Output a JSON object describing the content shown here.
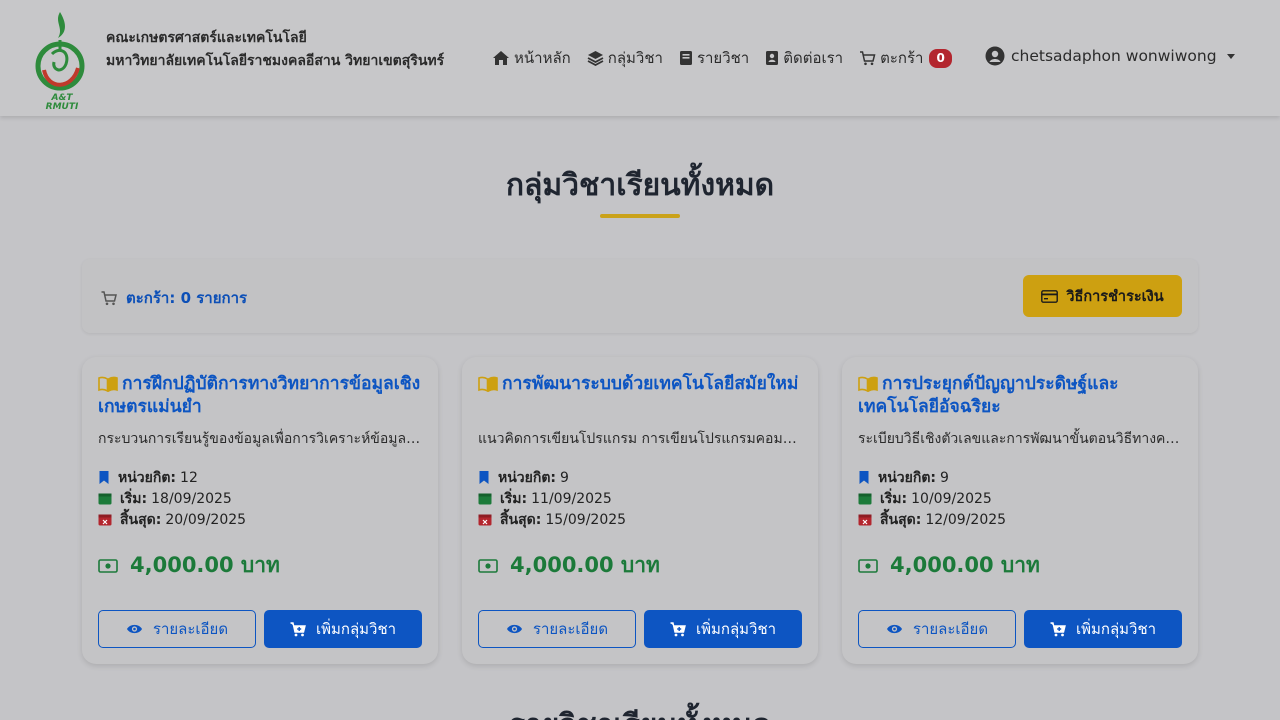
{
  "brand": {
    "logo_text": "A&T RMUTI",
    "line1": "คณะเกษตรศาสตร์และเทคโนโลยี",
    "line2": "มหาวิทยาลัยเทคโนโลยีราชมงคลอีสาน วิทยาเขตสุรินทร์"
  },
  "nav": {
    "home": "หน้าหลัก",
    "groups": "กลุ่มวิชา",
    "subjects": "รายวิชา",
    "contact": "ติดต่อเรา",
    "cart": "ตะกร้า",
    "cart_count": "0",
    "user": "chetsadaphon wonwiwong"
  },
  "page_title": "กลุ่มวิชาเรียนทั้งหมด",
  "cart_bar": {
    "summary": "ตะกร้า: 0 รายการ",
    "pay_button": "วิธีการชำระเงิน"
  },
  "labels": {
    "credits": "หน่วยกิต:",
    "start": "เริ่ม:",
    "end": "สิ้นสุด:",
    "detail_button": "รายละเอียด",
    "add_button": "เพิ่มกลุ่มวิชา"
  },
  "courses": [
    {
      "title": "การฝึกปฏิบัติการทางวิทยาการข้อมูลเชิงเกษตรแม่นยำ",
      "description": "กระบวนการเรียนรู้ของข้อมูลเพื่อการวิเคราะห์ข้อมูลเชิงเกษตรแม่นยำ",
      "credits": "12",
      "start": "18/09/2025",
      "end": "20/09/2025",
      "price": "4,000.00 บาท"
    },
    {
      "title": "การพัฒนาระบบด้วยเทคโนโลยีสมัยใหม่",
      "description": "แนวคิดการเขียนโปรแกรม การเขียนโปรแกรมคอมพิวเตอร์สมัยใหม่",
      "credits": "9",
      "start": "11/09/2025",
      "end": "15/09/2025",
      "price": "4,000.00 บาท"
    },
    {
      "title": "การประยุกต์ปัญญาประดิษฐ์และเทคโนโลยีอัจฉริยะ",
      "description": "ระเบียบวิธีเชิงตัวเลขและการพัฒนาขั้นตอนวิธีทางคอมพิวเตอร์",
      "credits": "9",
      "start": "10/09/2025",
      "end": "12/09/2025",
      "price": "4,000.00 บาท"
    }
  ],
  "next_section_title": "รายวิชาเรียนทั้งหมด",
  "colors": {
    "primary": "#0d55c2",
    "accent": "#cda011",
    "price": "#1c7a3a",
    "badge": "#b3262e"
  }
}
